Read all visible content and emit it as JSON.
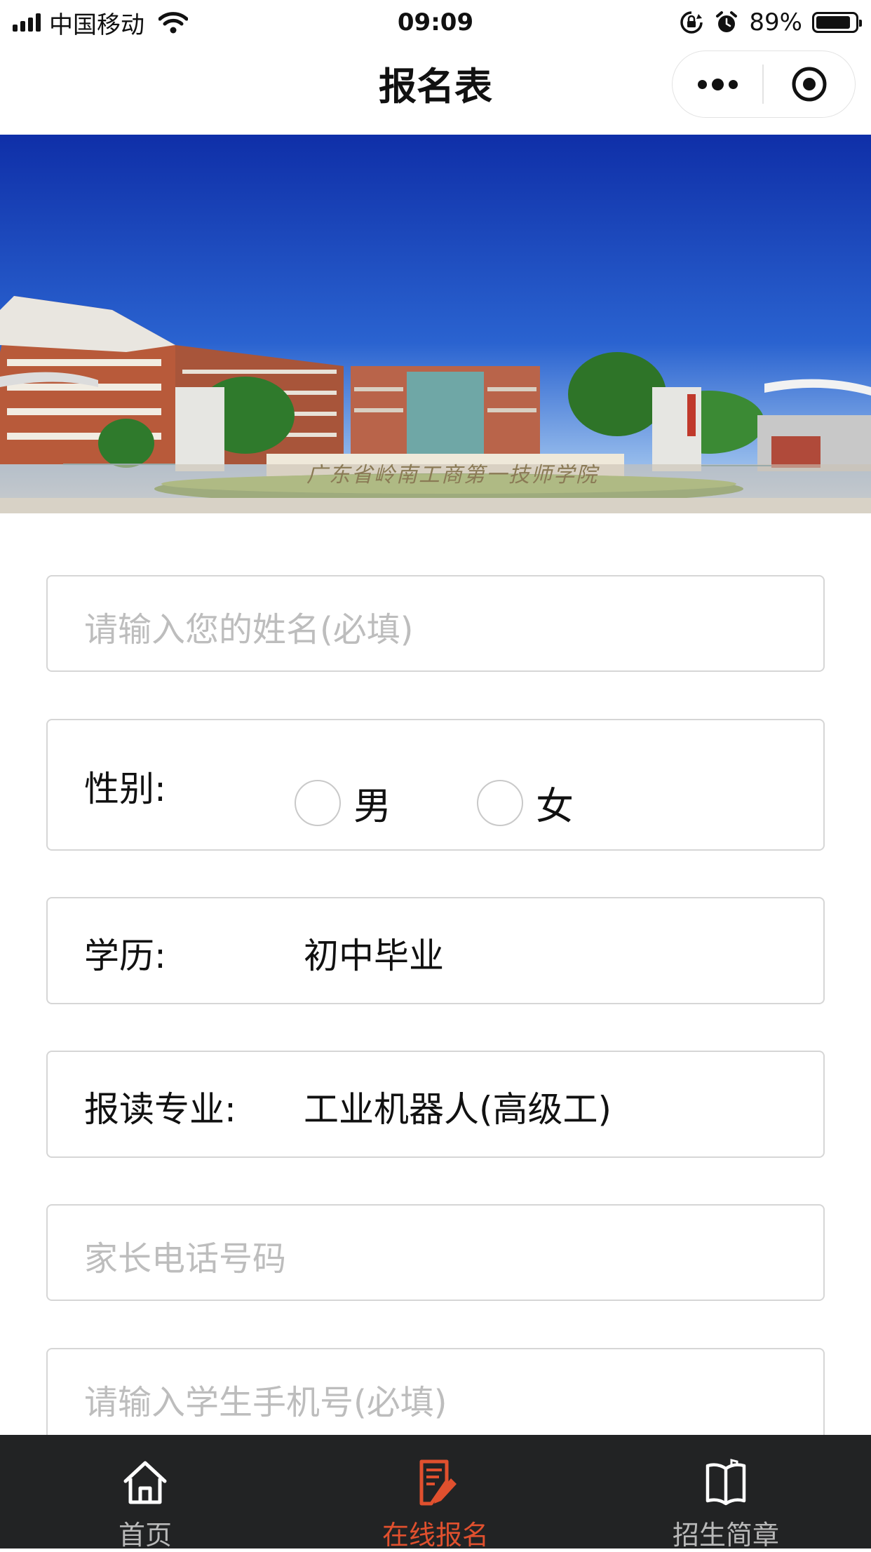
{
  "status_bar": {
    "carrier": "中国移动",
    "time": "09:09",
    "battery": "89%",
    "battery_level": 0.89
  },
  "nav": {
    "title": "报名表",
    "more_icon": "more-dots-icon",
    "close_icon": "target-close-icon"
  },
  "banner": {
    "sign_text": "广东省岭南工商第一技师学院"
  },
  "form": {
    "name": {
      "placeholder": "请输入您的姓名(必填)",
      "value": ""
    },
    "gender": {
      "label": "性别:",
      "options": [
        "男",
        "女"
      ],
      "selected": null
    },
    "education": {
      "label": "学历:",
      "value": "初中毕业"
    },
    "major": {
      "label": "报读专业:",
      "value": "工业机器人(高级工)"
    },
    "parent_phone": {
      "placeholder": "家长电话号码",
      "value": ""
    },
    "student_phone": {
      "placeholder": "请输入学生手机号(必填)",
      "value": ""
    }
  },
  "tabbar": {
    "items": [
      {
        "label": "首页",
        "icon": "home-icon",
        "active": false
      },
      {
        "label": "在线报名",
        "icon": "edit-form-icon",
        "active": true
      },
      {
        "label": "招生简章",
        "icon": "open-book-icon",
        "active": false
      }
    ],
    "active_color": "#e0502e",
    "inactive_color": "#b9b9b9",
    "background": "#222324"
  }
}
